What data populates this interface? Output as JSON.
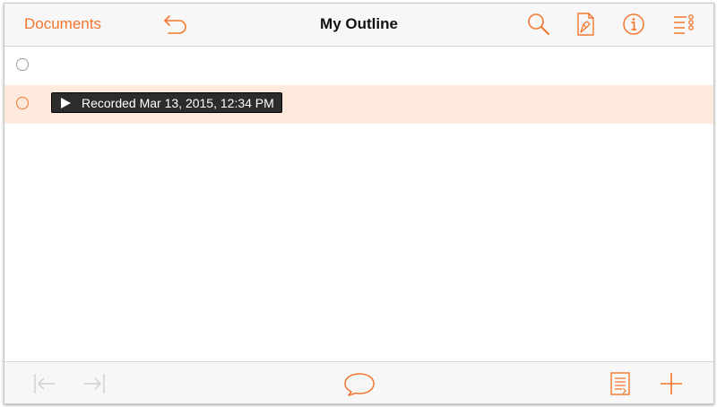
{
  "navbar": {
    "back_label": "Documents",
    "title": "My Outline",
    "icons": [
      "undo-icon",
      "search-icon",
      "style-icon",
      "info-icon",
      "outline-list-icon"
    ]
  },
  "outline": {
    "rows": [
      {
        "text": ""
      },
      {
        "attachment": "Recorded Mar 13, 2015, 12:34 PM",
        "selected": true
      }
    ]
  },
  "toolbar": {
    "icons": [
      "outdent-icon",
      "indent-icon",
      "note-icon",
      "inspector-icon",
      "add-icon"
    ]
  },
  "colors": {
    "accent": "#f2762e",
    "selected_row": "#feeadd",
    "bar_background": "#f7f7f7"
  }
}
